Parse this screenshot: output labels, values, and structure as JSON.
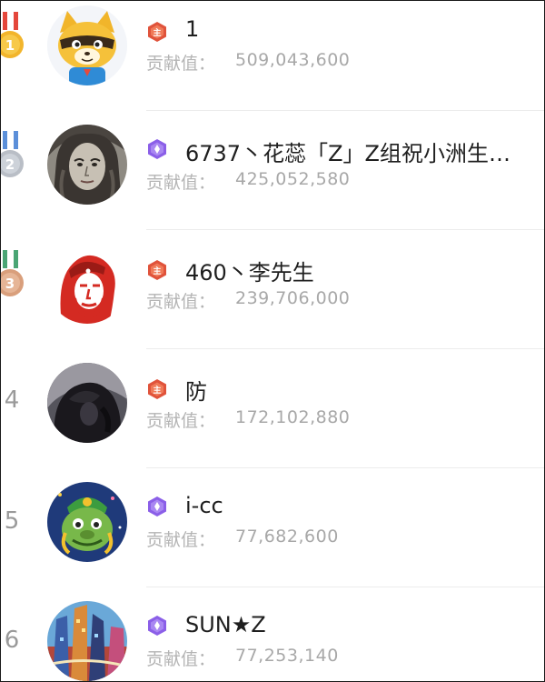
{
  "contribution_label": "贡献值：",
  "entries": [
    {
      "rank": "1",
      "name": "1",
      "contribution": "509,043,600",
      "level_badge": "red-level-badge",
      "avatar": "raccoon-cartoon-avatar"
    },
    {
      "rank": "2",
      "name": "6737丶花蕊「Z」Z组祝小洲生…",
      "contribution": "425,052,580",
      "level_badge": "purple-level-badge",
      "avatar": "portrait-drawing-avatar"
    },
    {
      "rank": "3",
      "name": "460丶李先生",
      "contribution": "239,706,000",
      "level_badge": "red-level-badge",
      "avatar": "che-guevara-avatar"
    },
    {
      "rank": "4",
      "name": "防",
      "contribution": "172,102,880",
      "level_badge": "red-level-badge",
      "avatar": "dark-photo-avatar"
    },
    {
      "rank": "5",
      "name": "i-cc",
      "contribution": "77,682,600",
      "level_badge": "purple-level-badge",
      "avatar": "green-cartoon-avatar"
    },
    {
      "rank": "6",
      "name": "SUN★Z",
      "contribution": "77,253,140",
      "level_badge": "purple-level-badge",
      "avatar": "city-painting-avatar"
    }
  ],
  "colors": {
    "gold_medal": "#f2b52c",
    "silver_medal": "#b9bec6",
    "bronze_medal": "#d99f7c",
    "red_badge": "#e0533b",
    "purple_badge": "#8b5fe8",
    "name_text": "#1f1f1f",
    "contribution_text": "#a8a8a8"
  }
}
